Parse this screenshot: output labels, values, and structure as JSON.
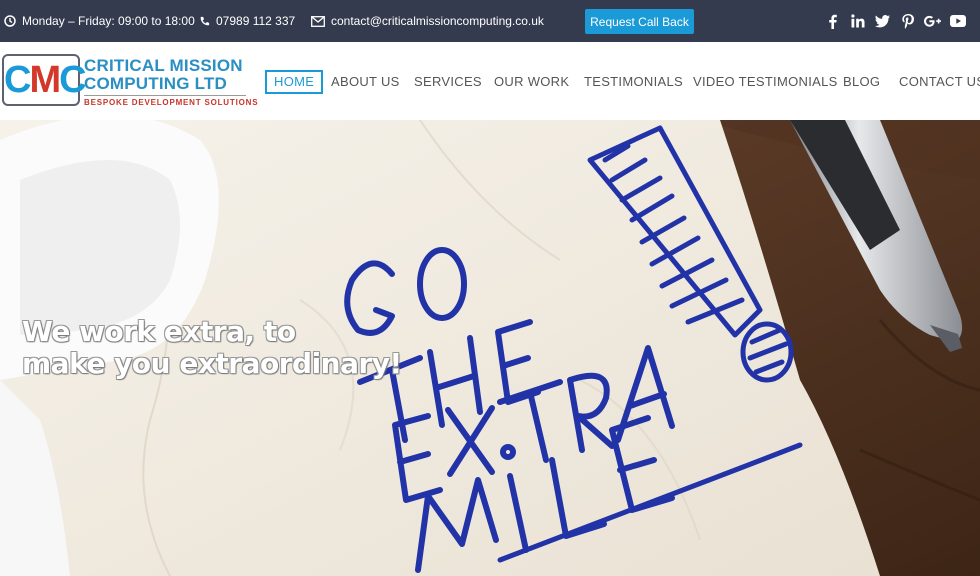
{
  "topbar": {
    "hours": "Monday – Friday: 09:00 to 18:00",
    "phone": "07989 112 337",
    "email": "contact@criticalmissioncomputing.co.uk",
    "callback_label": "Request Call Back",
    "social_icons": [
      "facebook-icon",
      "linkedin-icon",
      "twitter-icon",
      "pinterest-icon",
      "google-plus-icon",
      "youtube-icon"
    ]
  },
  "logo": {
    "mark": "CMC",
    "line1": "CRITICAL MISSION",
    "line2": "COMPUTING LTD",
    "tagline": "BESPOKE DEVELOPMENT SOLUTIONS"
  },
  "nav": {
    "items": [
      {
        "label": "HOME",
        "active": true
      },
      {
        "label": "ABOUT US"
      },
      {
        "label": "SERVICES"
      },
      {
        "label": "OUR WORK"
      },
      {
        "label": "TESTIMONIALS"
      },
      {
        "label": "VIDEO TESTIMONIALS"
      },
      {
        "label": "BLOG"
      },
      {
        "label": "CONTACT US"
      }
    ]
  },
  "hero": {
    "headline_line1": "We work extra, to",
    "headline_line2": "make you extraordinary!",
    "napkin_words": [
      "GO",
      "THE",
      "EXTRA",
      "MILE"
    ]
  },
  "colors": {
    "topbar_bg": "#343b4e",
    "accent": "#1a9ad6",
    "logo_red": "#d3392b",
    "marker_blue": "#2233a8"
  }
}
